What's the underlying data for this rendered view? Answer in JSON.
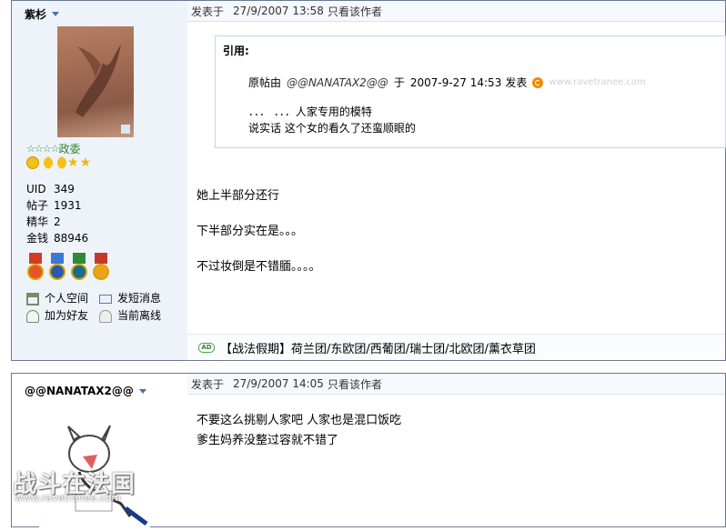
{
  "post1": {
    "username": "紫杉",
    "rank": {
      "stars": "☆☆☆☆",
      "title": "政委"
    },
    "stats": [
      {
        "label": "UID",
        "value": "349"
      },
      {
        "label": "帖子",
        "value": "1931"
      },
      {
        "label": "精华",
        "value": "2"
      },
      {
        "label": "金钱",
        "value": "88946"
      }
    ],
    "links": {
      "space": "个人空间",
      "pm": "发短消息",
      "friend": "加为好友",
      "status": "当前离线"
    },
    "header": {
      "posted_at": "发表于",
      "time": "27/9/2007 13:58",
      "only_author": "只看该作者"
    },
    "quote": {
      "label": "引用:",
      "orig_prefix": "原帖由",
      "orig_author": "@@NANATAX2@@",
      "yu": "于",
      "date": "2007-9-27 14:53",
      "posted": "发表",
      "watermark": "www.ravetranee.com",
      "line1": "．．．  ．．．人家专用的模特",
      "line2": "说实话 这个女的看久了还蛮顺眼的"
    },
    "body": [
      "她上半部分还行",
      "下半部分实在是。。。",
      "不过妆倒是不错腼。。。。"
    ],
    "ad": {
      "icon": "AD",
      "text": "【战法假期】荷兰团/东欧团/西葡团/瑞士团/北欧团/薰衣草团"
    }
  },
  "post2": {
    "username": "@@NANATAX2@@",
    "header": {
      "posted_at": "发表于",
      "time": "27/9/2007 14:05",
      "only_author": "只看该作者"
    },
    "body": [
      "不要这么挑剔人家吧 人家也是混口饭吃",
      "爹生妈养没整过容就不错了"
    ]
  },
  "watermark": {
    "text": "战斗在法国",
    "url": "www.ravetranee.com"
  },
  "colors": {
    "sidebar_bg": "#eef3fa",
    "border": "#6b7b8c",
    "rank_green": "#2b8a2b"
  }
}
